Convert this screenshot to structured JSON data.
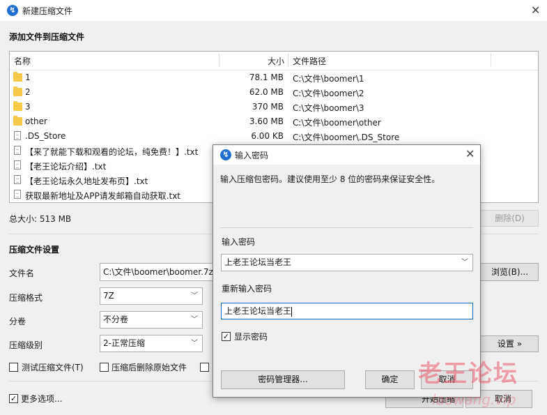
{
  "window": {
    "title": "新建压缩文件",
    "close_glyph": "✕"
  },
  "add_section": {
    "title": "添加文件到压缩文件",
    "columns": {
      "name": "名称",
      "size": "大小",
      "path": "文件路径"
    },
    "rows": [
      {
        "icon": "folder",
        "name": "1",
        "size": "78.1 MB",
        "path": "C:\\文件\\boomer\\1"
      },
      {
        "icon": "folder",
        "name": "2",
        "size": "62.0 MB",
        "path": "C:\\文件\\boomer\\2"
      },
      {
        "icon": "folder",
        "name": "3",
        "size": "370 MB",
        "path": "C:\\文件\\boomer\\3"
      },
      {
        "icon": "folder",
        "name": "other",
        "size": "3.60 MB",
        "path": "C:\\文件\\boomer\\other"
      },
      {
        "icon": "file",
        "name": ".DS_Store",
        "size": "6.00 KB",
        "path": "C:\\文件\\boomer\\.DS_Store"
      },
      {
        "icon": "file",
        "name": "【来了就能下载和观看的论坛，纯免费！】.txt",
        "size": "",
        "path": ""
      },
      {
        "icon": "file",
        "name": "【老王论坛介绍】.txt",
        "size": "",
        "path": ""
      },
      {
        "icon": "file",
        "name": "【老王论坛永久地址发布页】.txt",
        "size": "",
        "path": ""
      },
      {
        "icon": "file",
        "name": "获取最新地址及APP请发邮箱自动获取.txt",
        "size": "",
        "path": ""
      }
    ],
    "total_label": "总大小: 513 MB",
    "delete_button": "删除(D)"
  },
  "settings": {
    "title": "压缩文件设置",
    "filename_label": "文件名",
    "filename_value": "C:\\文件\\boomer\\boomer.7z",
    "browse_button": "浏览(B)...",
    "format_label": "压缩格式",
    "format_value": "7Z",
    "split_label": "分卷",
    "split_value": "不分卷",
    "level_label": "压缩级别",
    "level_value": "2-正常压缩",
    "advanced_button": "设置 »",
    "test_checkbox": "测试压缩文件(T)",
    "delete_after_checkbox": "压缩后删除原始文件",
    "more_options": "更多选项...",
    "start_button": "开始压缩",
    "cancel_button": "取消"
  },
  "dialog": {
    "title": "输入密码",
    "close_glyph": "✕",
    "description": "输入压缩包密码。建议使用至少 8 位的密码来保证安全性。",
    "password_label": "输入密码",
    "password_value": "上老王论坛当老王",
    "confirm_label": "重新输入密码",
    "confirm_value": "上老王论坛当老王",
    "show_password": "显示密码",
    "manager_button": "密码管理器...",
    "ok_button": "确定",
    "cancel_button": "取消"
  },
  "watermark": {
    "text": "老王论坛",
    "subtext": "laowang.vip"
  },
  "colors": {
    "accent": "#1f6fd1",
    "watermark": "#eb5a6e",
    "folder": "#f7c948"
  }
}
